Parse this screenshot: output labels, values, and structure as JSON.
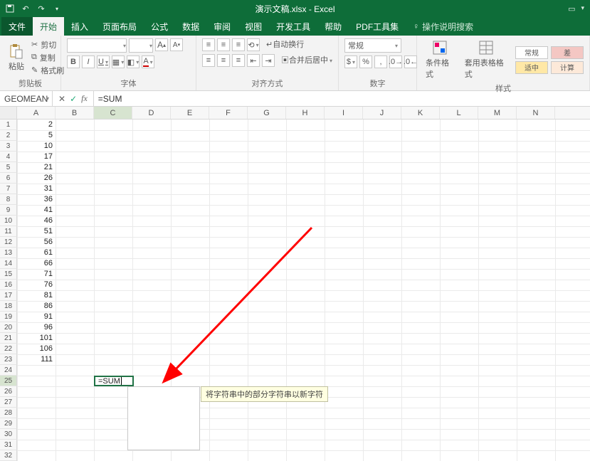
{
  "app": {
    "title_doc": "演示文稿.xlsx",
    "title_app": "Excel"
  },
  "qat": {
    "save": "save-icon",
    "undo": "undo-icon",
    "redo": "redo-icon"
  },
  "tabs": {
    "file": "文件",
    "home": "开始",
    "insert": "插入",
    "layout": "页面布局",
    "formulas": "公式",
    "data": "数据",
    "review": "审阅",
    "view": "视图",
    "dev": "开发工具",
    "help": "帮助",
    "pdf": "PDF工具集",
    "tell_me": "操作说明搜索"
  },
  "ribbon": {
    "clipboard": {
      "paste": "粘贴",
      "cut": "剪切",
      "copy": "复制",
      "painter": "格式刷",
      "label": "剪贴板"
    },
    "font": {
      "name": "",
      "size": "",
      "inc": "A",
      "dec": "A",
      "bold": "B",
      "italic": "I",
      "underline": "U",
      "label": "字体"
    },
    "align": {
      "wrap": "自动换行",
      "merge": "合并后居中",
      "label": "对齐方式"
    },
    "number": {
      "format": "常规",
      "label": "数字"
    },
    "styles": {
      "cond": "条件格式",
      "table": "套用表格格式",
      "normal": "常规",
      "good": "适中",
      "calc": "计算",
      "label": "样式"
    }
  },
  "fx": {
    "namebox": "GEOMEAN",
    "cancel": "✕",
    "enter": "✓",
    "fx": "fx",
    "formula": "=SUM"
  },
  "columns": [
    "A",
    "B",
    "C",
    "D",
    "E",
    "F",
    "G",
    "H",
    "I",
    "J",
    "K",
    "L",
    "M",
    "N"
  ],
  "row_count": 32,
  "colA_values": {
    "1": 2,
    "2": 5,
    "3": 10,
    "4": 17,
    "5": 21,
    "6": 26,
    "7": 31,
    "8": 36,
    "9": 41,
    "10": 46,
    "11": 51,
    "12": 56,
    "13": 61,
    "14": 66,
    "15": 71,
    "16": 76,
    "17": 81,
    "18": 86,
    "19": 91,
    "20": 96,
    "21": 101,
    "22": 106,
    "23": 111
  },
  "active": {
    "row": 25,
    "col": "C",
    "text": "=SUM"
  },
  "tooltip": "将字符串中的部分字符串以新字符",
  "colors": {
    "accent": "#0e6d39",
    "select": "#217346"
  }
}
